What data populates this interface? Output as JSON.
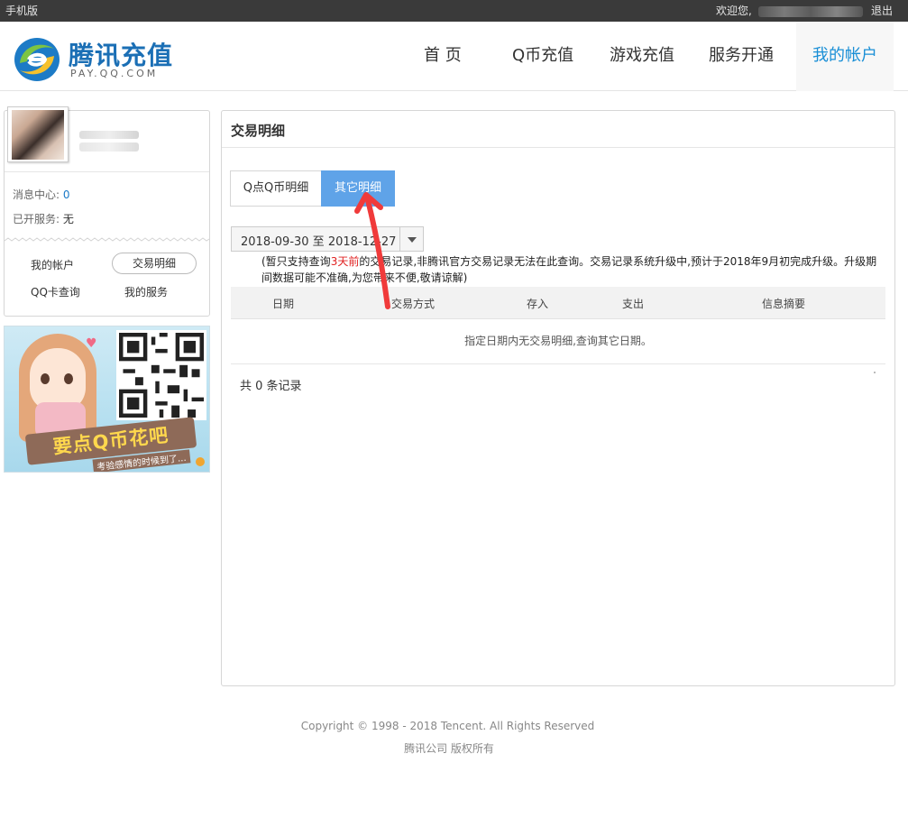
{
  "topbar": {
    "mobile": "手机版",
    "welcome": "欢迎您,",
    "logout": "退出"
  },
  "header": {
    "logo_cn": "腾讯充值",
    "logo_en": "PAY.QQ.COM",
    "nav": [
      {
        "label": "首  页"
      },
      {
        "label": "Q币充值"
      },
      {
        "label": "游戏充值"
      },
      {
        "label": "服务开通"
      },
      {
        "label": "我的帐户",
        "active": true
      }
    ]
  },
  "sidebar": {
    "message_center_label": "消息中心:",
    "message_center_count": "0",
    "services_label": "已开服务:",
    "services_value": "无",
    "links": [
      {
        "label": "我的帐户"
      },
      {
        "label": "交易明细",
        "active": true
      },
      {
        "label": "QQ卡查询"
      },
      {
        "label": "我的服务"
      }
    ],
    "banner": {
      "slogan": "要点Q币花吧",
      "sub": "考验感情的时候到了..."
    }
  },
  "main": {
    "title": "交易明细",
    "tabs": [
      {
        "label": "Q点Q币明细"
      },
      {
        "label": "其它明细",
        "active": true
      }
    ],
    "date_range": "2018-09-30 至 2018-12-27",
    "notice_prefix": "(暂只支持查询",
    "notice_red": "3天前",
    "notice_suffix": "的交易记录,非腾讯官方交易记录无法在此查询。交易记录系统升级中,预计于2018年9月初完成升级。升级期间数据可能不准确,为您带来不便,敬请谅解)",
    "columns": [
      "日期",
      "交易方式",
      "存入",
      "支出",
      "信息摘要"
    ],
    "empty_text": "指定日期内无交易明细,查询其它日期。",
    "total_text": "共 0 条记录"
  },
  "footer": {
    "copyright": "Copyright © 1998 - 2018 Tencent. All Rights Reserved",
    "company": "腾讯公司 版权所有"
  },
  "colors": {
    "accent": "#5fa3e8",
    "nav_active": "#1a8fd6",
    "brand": "#1b6fb5",
    "notice_red": "#e02020"
  }
}
